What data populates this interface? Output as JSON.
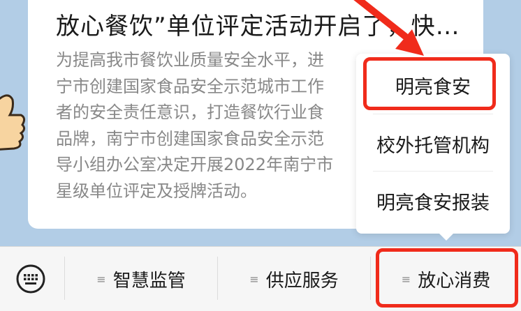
{
  "article": {
    "headline": "放心餐饮”单位评定活动开启了，快…",
    "description_lines": [
      "为提高我市餐饮业质量安全水平，进",
      "宁市创建国家食品安全示范城市工作",
      "者的安全责任意识，打造餐饮行业食",
      "品牌，南宁市创建国家食品安全示范",
      "导小组办公室决定开展2022年南宁市",
      "星级单位评定及授牌活动。"
    ]
  },
  "popup_menu": {
    "items": [
      {
        "label": "明亮食安"
      },
      {
        "label": "校外托管机构"
      },
      {
        "label": "明亮食安报装"
      }
    ]
  },
  "bottom_menu": {
    "keyboard_icon": "keyboard-icon",
    "items": [
      {
        "label": "智慧监管"
      },
      {
        "label": "供应服务"
      },
      {
        "label": "放心消费"
      }
    ],
    "menu_glyph": "≡"
  },
  "annotation_color": "#f02b1b"
}
